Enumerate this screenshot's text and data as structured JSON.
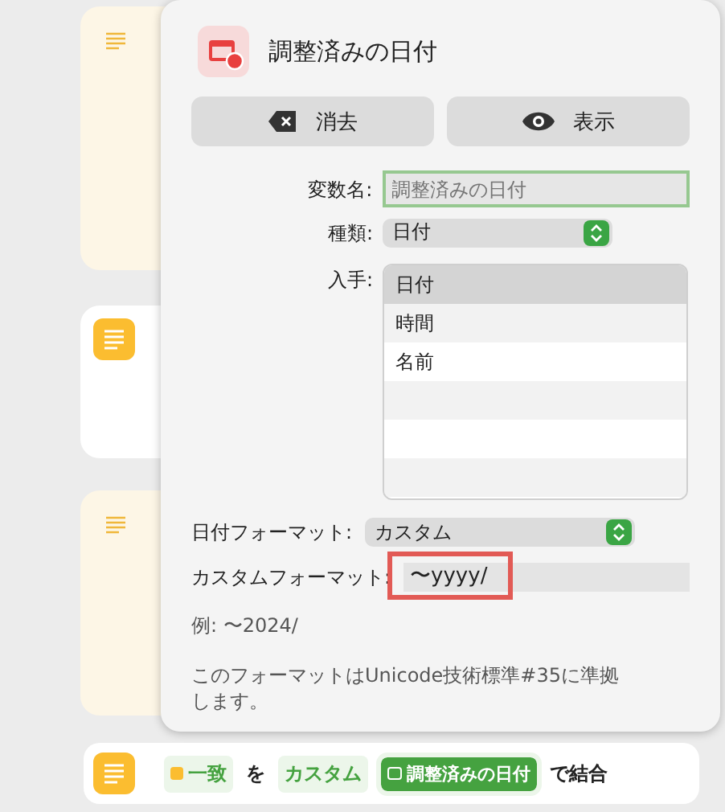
{
  "popover": {
    "title": "調整済みの日付",
    "buttons": [
      {
        "kind": "clear",
        "label": "消去"
      },
      {
        "kind": "show",
        "label": "表示"
      }
    ],
    "variable_name": {
      "label": "変数名:",
      "placeholder": "調整済みの日付"
    },
    "type": {
      "label": "種類:",
      "value": "日付"
    },
    "get": {
      "label": "入手:",
      "items": [
        {
          "label": "日付",
          "selected": true
        },
        {
          "label": "時間",
          "selected": false
        },
        {
          "label": "名前",
          "selected": false
        }
      ]
    },
    "date_format": {
      "label": "日付フォーマット:",
      "value": "カスタム"
    },
    "custom_format": {
      "label": "カスタムフォーマット:",
      "value": "〜yyyy/",
      "highlighted": true
    },
    "example": "例: 〜2024/",
    "note": "このフォーマットはUnicode技術標準#35に準拠します。"
  },
  "action_row": {
    "tokens": [
      {
        "kind": "variable",
        "text": "一致"
      },
      {
        "kind": "plain",
        "text": "を"
      },
      {
        "kind": "param",
        "text": "カスタム"
      },
      {
        "kind": "magic",
        "text": "調整済みの日付"
      },
      {
        "kind": "plain",
        "text": "で結合"
      }
    ]
  }
}
